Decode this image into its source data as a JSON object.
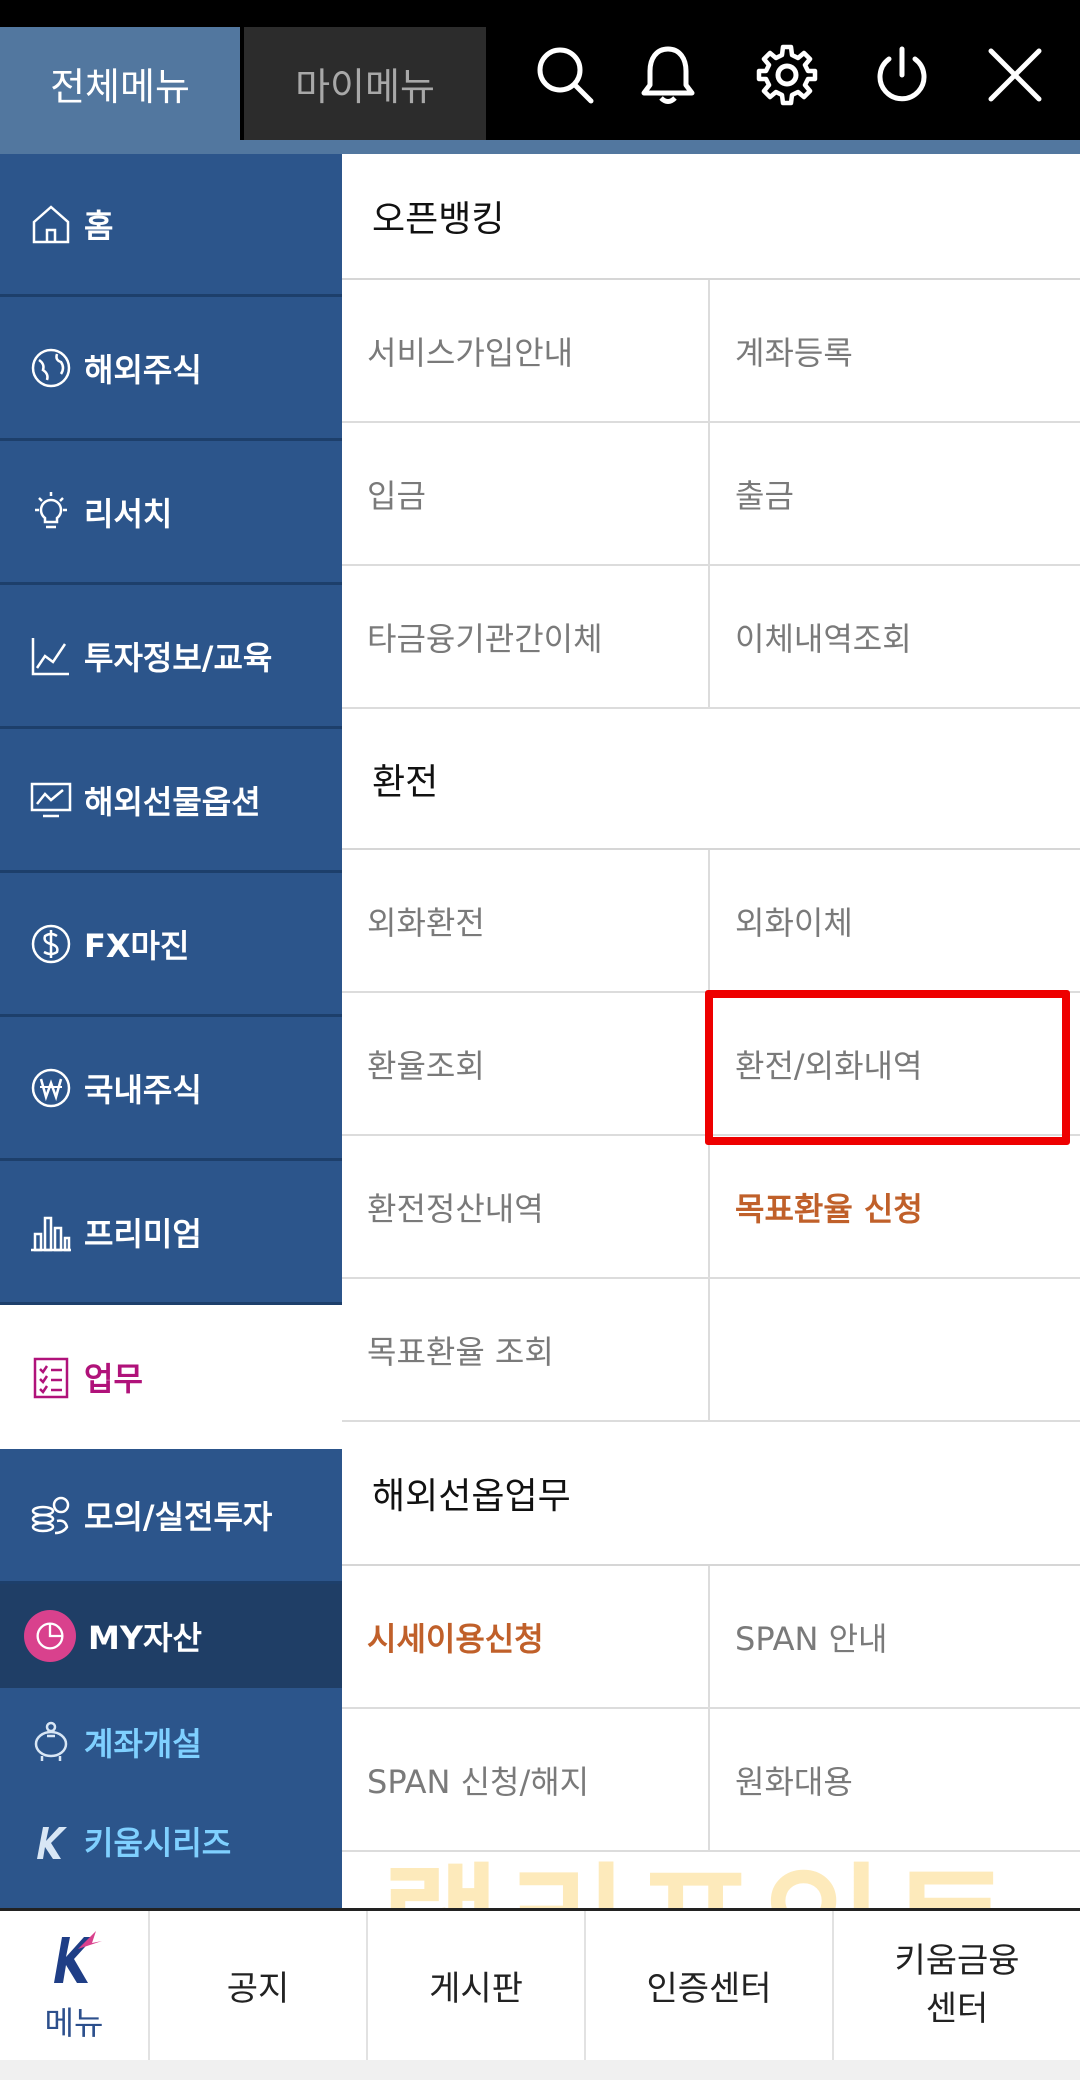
{
  "header": {
    "tab_all": "전체메뉴",
    "tab_my": "마이메뉴",
    "icons": [
      "search-icon",
      "bell-icon",
      "gear-icon",
      "power-icon",
      "close-icon"
    ]
  },
  "sidebar": {
    "items": [
      {
        "label": "홈",
        "icon": "home-icon"
      },
      {
        "label": "해외주식",
        "icon": "globe-icon"
      },
      {
        "label": "리서치",
        "icon": "lightbulb-icon"
      },
      {
        "label": "투자정보/교육",
        "icon": "line-chart-icon"
      },
      {
        "label": "해외선물옵션",
        "icon": "monitor-chart-icon"
      },
      {
        "label": "FX마진",
        "icon": "dollar-icon"
      },
      {
        "label": "국내주식",
        "icon": "won-icon"
      },
      {
        "label": "프리미엄",
        "icon": "bar-chart-icon"
      },
      {
        "label": "업무",
        "icon": "checklist-icon"
      },
      {
        "label": "모의/실전투자",
        "icon": "coins-icon"
      }
    ],
    "my_asset": "MY자산",
    "account_open": "계좌개설",
    "kiwoom_series": "키움시리즈"
  },
  "content": {
    "open_banking": {
      "title": "오픈뱅킹",
      "cells": [
        "서비스가입안내",
        "계좌등록",
        "입금",
        "출금",
        "타금융기관간이체",
        "이체내역조회"
      ]
    },
    "exchange": {
      "title": "환전",
      "cells": [
        "외화환전",
        "외화이체",
        "환율조회",
        "환전/외화내역",
        "환전정산내역",
        "목표환율 신청",
        "목표환율 조회",
        ""
      ]
    },
    "overseas_futures": {
      "title": "해외선옵업무",
      "cells": [
        "시세이용신청",
        "SPAN 안내",
        "SPAN 신청/해지",
        "원화대용"
      ]
    }
  },
  "watermark": "랠리포인트",
  "bottom": {
    "menu_label": "메뉴",
    "notice": "공지",
    "board": "게시판",
    "cert_center": "인증센터",
    "finance_center_line1": "키움금융",
    "finance_center_line2": "센터"
  },
  "colors": {
    "sidebar_bg": "#2c558b",
    "active_text": "#b0127a",
    "accent_orange": "#c0602a",
    "highlight_red": "#ee0000",
    "sub_link": "#7fd0ff"
  }
}
